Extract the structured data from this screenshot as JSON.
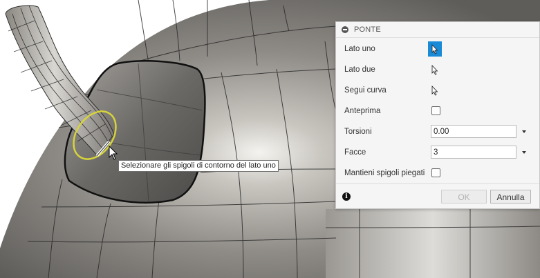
{
  "tooltip": {
    "text": "Selezionare gli spigoli di contorno del lato uno"
  },
  "panel": {
    "title": "PONTE",
    "rows": {
      "lato_uno": "Lato uno",
      "lato_due": "Lato due",
      "segui_curva": "Segui curva",
      "anteprima": "Anteprima",
      "torsioni": "Torsioni",
      "facce": "Facce",
      "mantieni": "Mantieni spigoli piegati"
    },
    "torsioni_value": "0.00",
    "facce_value": "3",
    "anteprima_checked": false,
    "mantieni_checked": false,
    "active_selection": "lato_uno"
  },
  "buttons": {
    "ok": "OK",
    "annulla": "Annulla"
  },
  "icons": {
    "collapse": "minus-circle-icon",
    "select": "arrow-cursor-icon",
    "info": "info-icon",
    "dropdown": "chevron-down-icon"
  },
  "colors": {
    "accent": "#1a8ad6",
    "selection_ring": "#d7d43a",
    "model_surface": "#8a8782"
  }
}
